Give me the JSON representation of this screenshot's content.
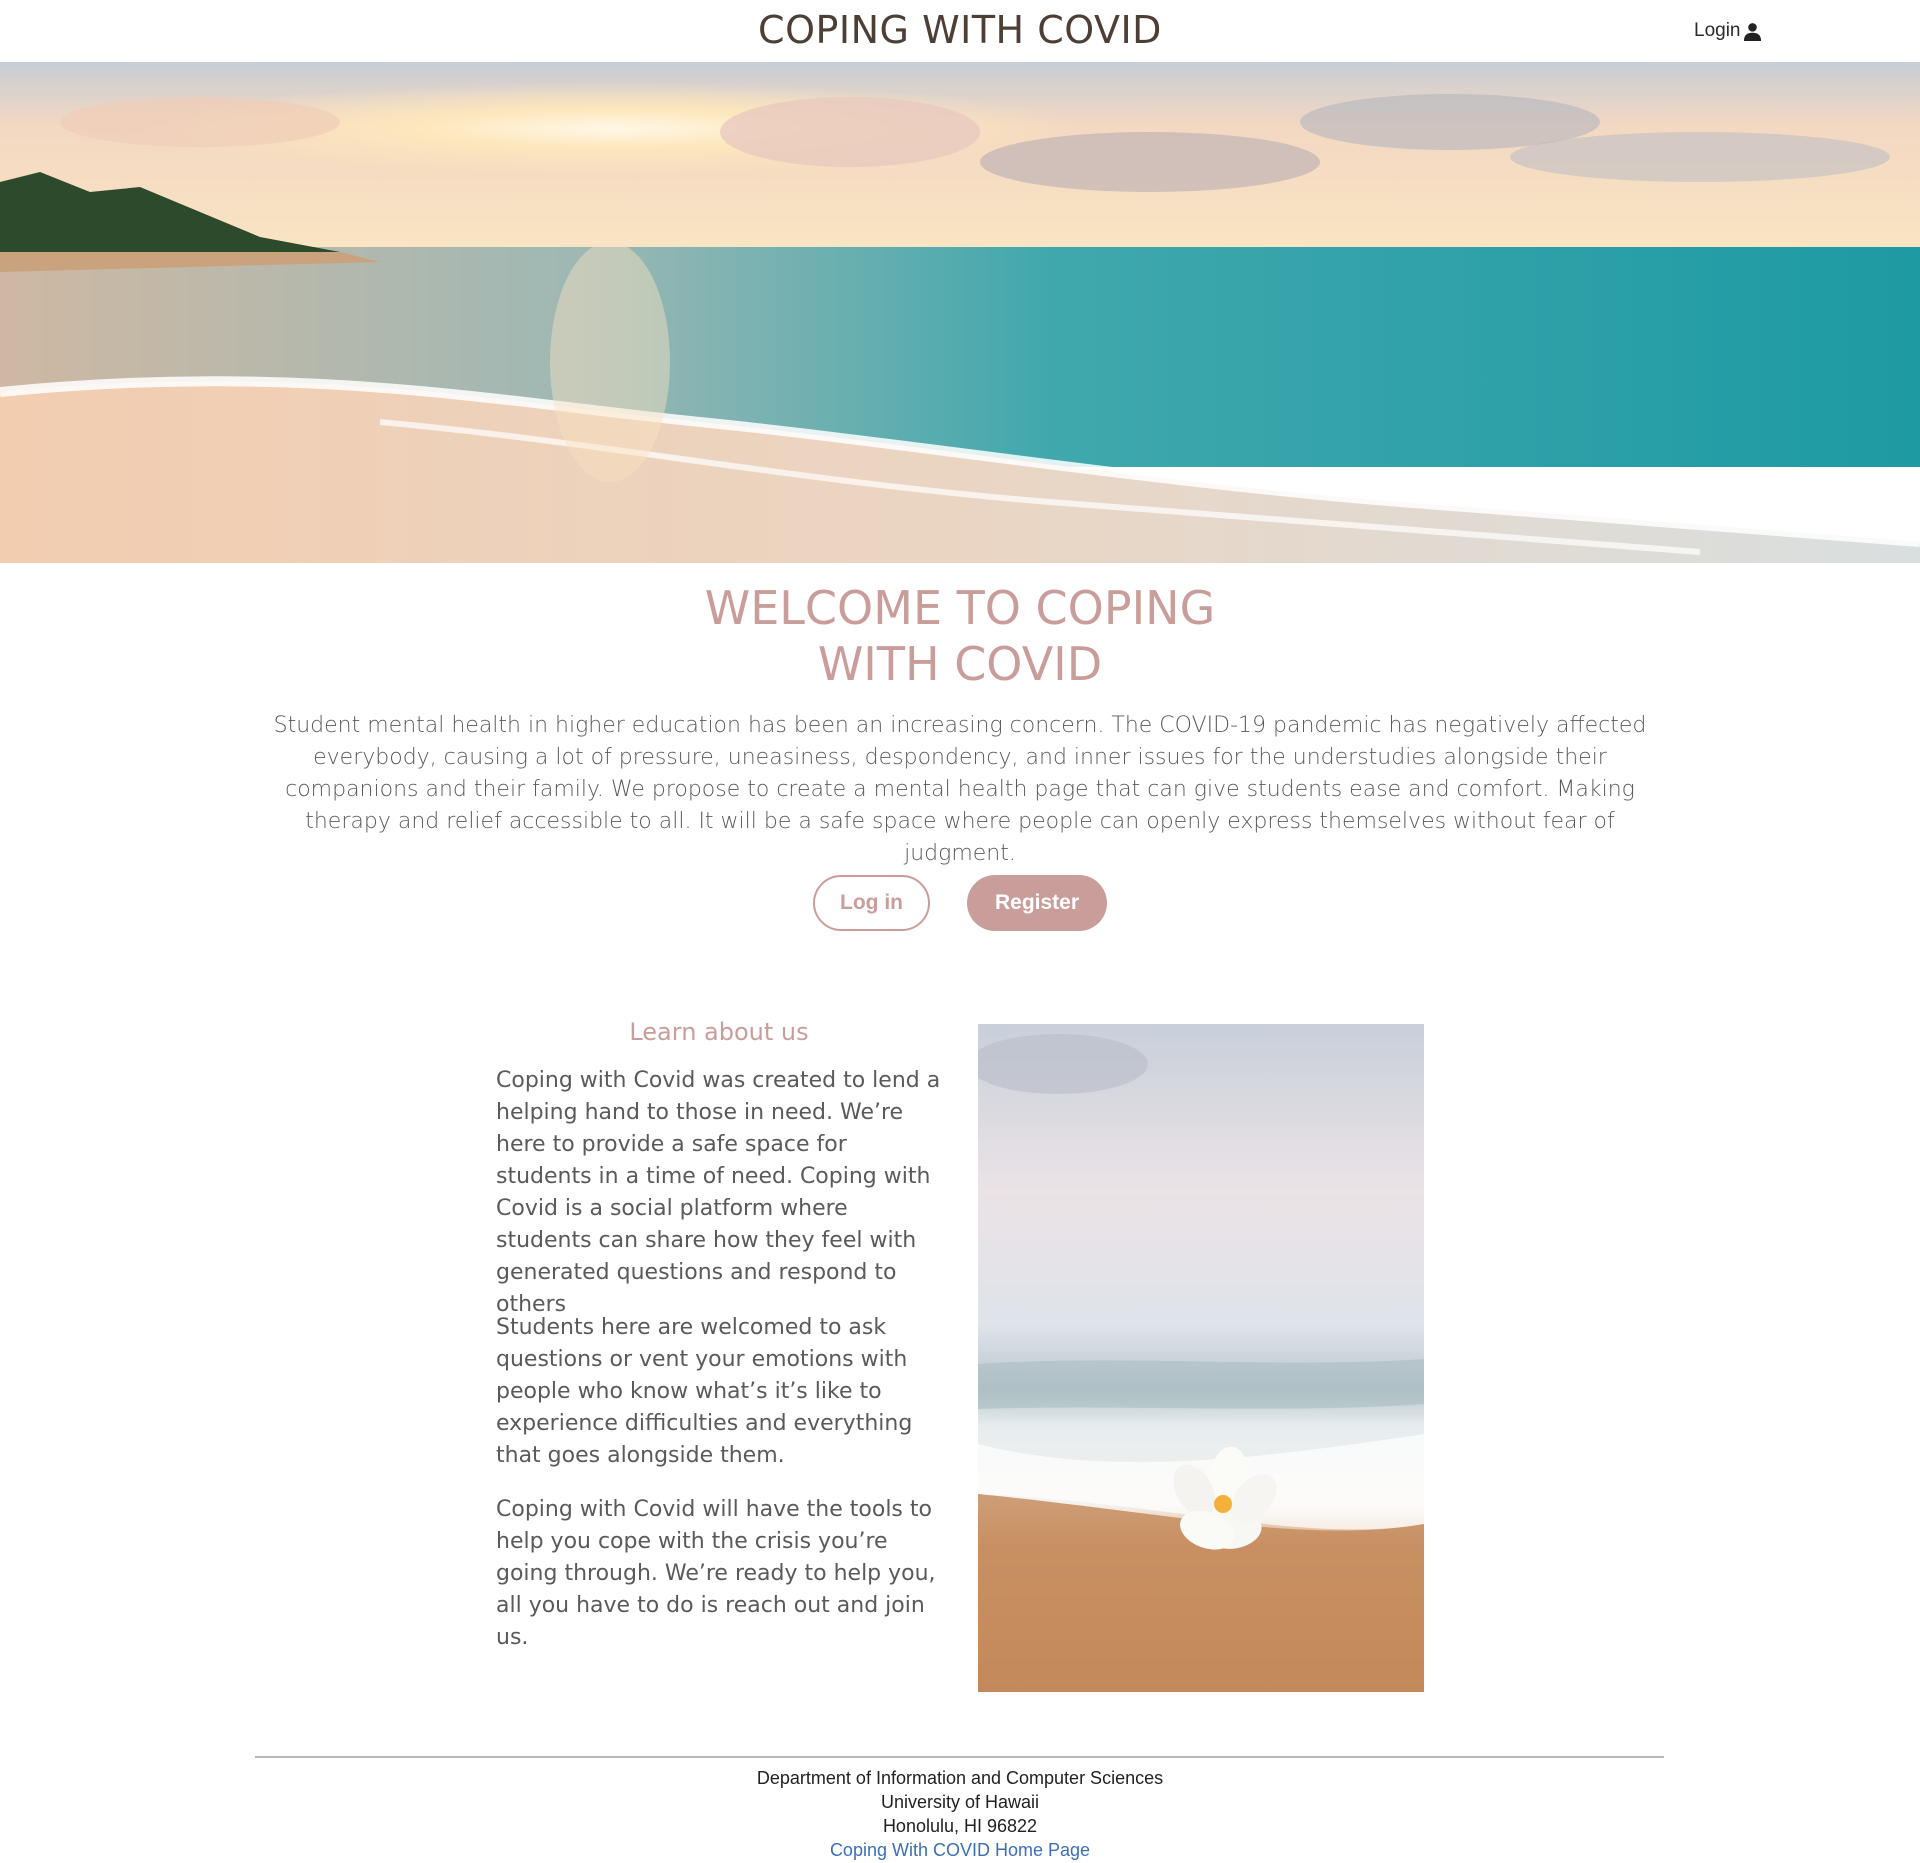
{
  "navbar": {
    "brand": "COPING WITH COVID",
    "login_label": "Login",
    "login_icon": "user-icon"
  },
  "hero": {
    "image_description_icon": "beach-sunset-image"
  },
  "welcome": {
    "title_line1": "WELCOME TO COPING",
    "title_line2": "WITH COVID",
    "text": "Student mental health in higher education has been an increasing concern. The COVID-19 pandemic has negatively affected everybody, causing a lot of pressure, uneasiness, despondency, and inner issues for the understudies alongside their companions and their family. We propose to create a mental health page that can give students ease and comfort. Making therapy and relief accessible to all. It will be a safe space where people can openly express themselves without fear of judgment.",
    "login_button": "Log in",
    "register_button": "Register"
  },
  "about": {
    "heading": "Learn about us",
    "paragraphs": [
      "Coping with Covid was created to lend a helping hand to those in need. We’re here to provide a safe space for students in a time of need. Coping with Covid is a social platform where students can share how they feel with generated questions and respond to others",
      "Students here are welcomed to ask questions or vent your emotions with people who know what’s it’s like to experience difficulties and everything that goes alongside them.",
      "Coping with Covid will have the tools to help you cope with the crisis you’re going through. We’re ready to help you, all you have to do is reach out and join us."
    ]
  },
  "footer": {
    "department": "Department of Information and Computer Sciences",
    "university": "University of Hawaii",
    "address": "Honolulu, HI 96822",
    "home_link": "Coping With COVID Home Page"
  },
  "colors": {
    "accent": "#c99e9a",
    "brand_text": "#4d3f36",
    "body_text": "#5a5a5a",
    "link": "#3b6fb6"
  }
}
